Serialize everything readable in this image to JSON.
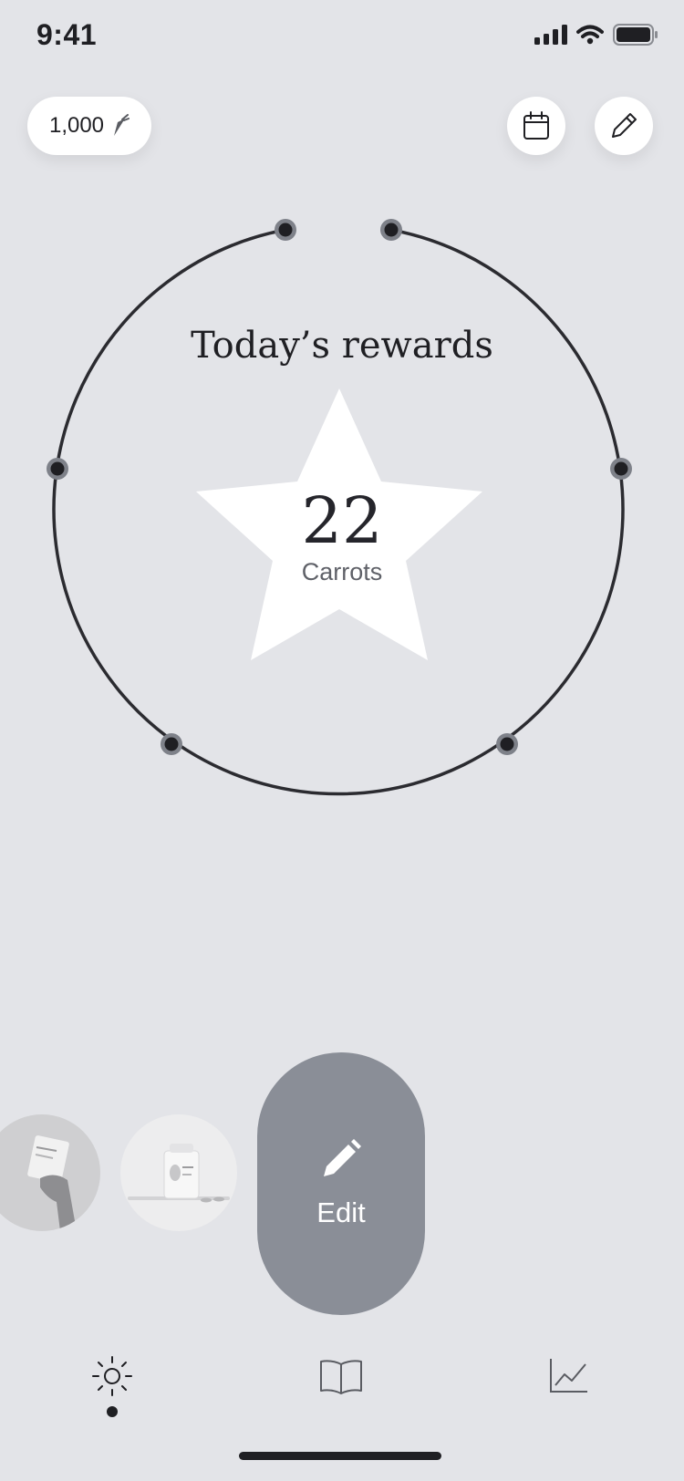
{
  "status_bar": {
    "time": "9:41"
  },
  "header": {
    "balance": "1,000"
  },
  "rewards": {
    "title": "Today’s rewards",
    "count": "22",
    "unit": "Carrots"
  },
  "edit_button": {
    "label": "Edit"
  },
  "colors": {
    "background": "#e3e4e8",
    "ring": "#2b2b30",
    "fab": "#8a8e97",
    "node": "#1f1f23"
  },
  "icons": {
    "header": [
      "carrot-icon",
      "calendar-icon",
      "pencil-icon"
    ],
    "tab_bar": [
      "sun-icon",
      "book-icon",
      "chart-icon"
    ]
  }
}
